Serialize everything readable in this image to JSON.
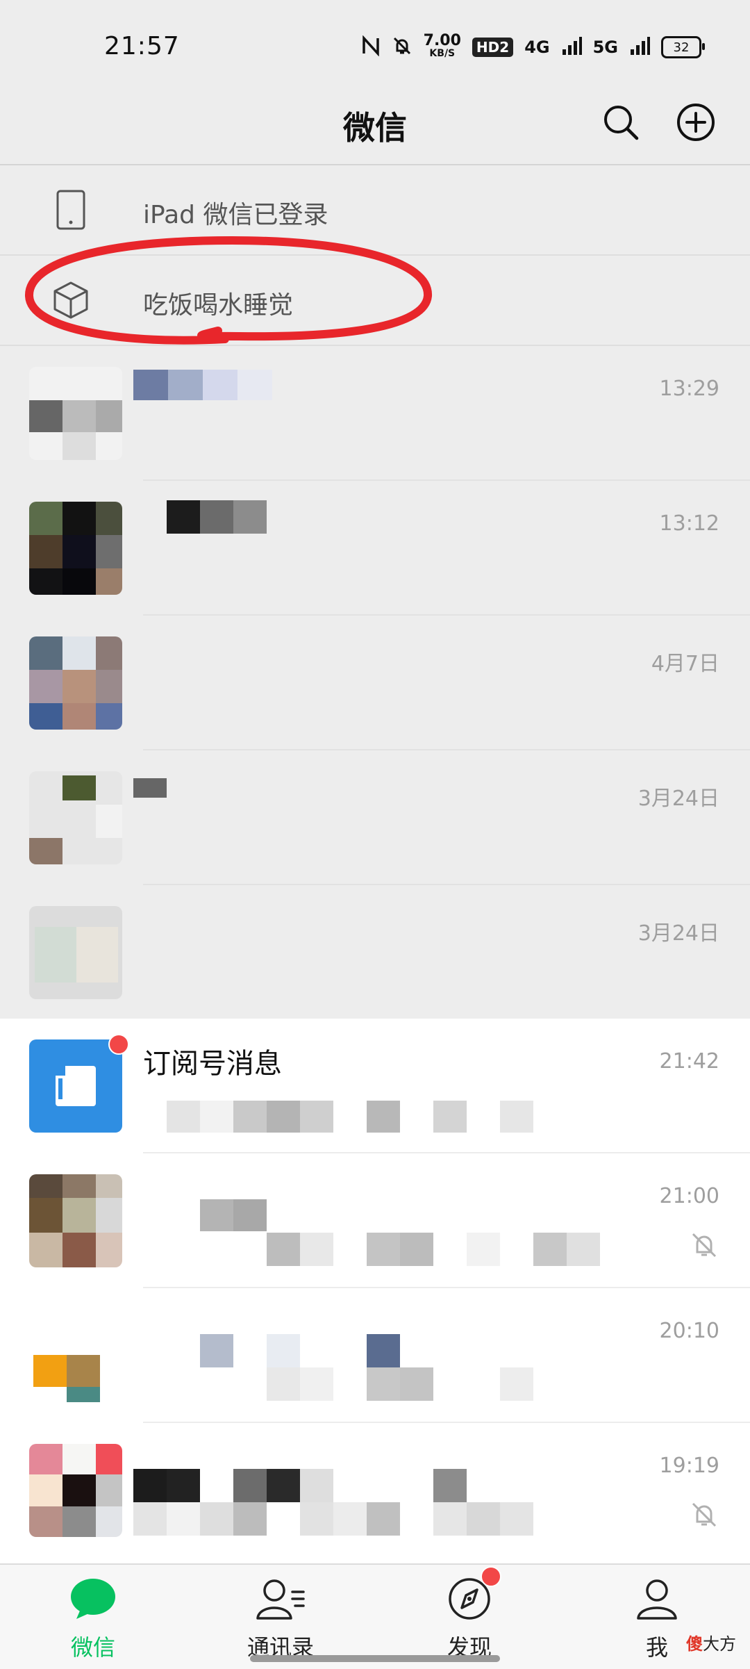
{
  "status_bar": {
    "time": "21:57",
    "speed_value": "7.00",
    "speed_unit": "KB/S",
    "hd_label": "HD2",
    "net_4g": "4G",
    "net_5g": "5G",
    "battery": "32"
  },
  "header": {
    "title": "微信"
  },
  "device_row": {
    "text": "iPad 微信已登录"
  },
  "fold_row": {
    "text": "吃饭喝水睡觉"
  },
  "chats": [
    {
      "time": "13:29",
      "muted": false
    },
    {
      "time": "13:12",
      "muted": false
    },
    {
      "time": "4月7日",
      "muted": false
    },
    {
      "time": "3月24日",
      "muted": false
    },
    {
      "time": "3月24日",
      "muted": false
    },
    {
      "name": "订阅号消息",
      "time": "21:42",
      "muted": false,
      "badge": true
    },
    {
      "time": "21:00",
      "muted": true
    },
    {
      "time": "20:10",
      "muted": false
    },
    {
      "time": "19:19",
      "muted": true
    }
  ],
  "tabs": [
    {
      "label": "微信",
      "active": true
    },
    {
      "label": "通讯录",
      "active": false
    },
    {
      "label": "发现",
      "active": false,
      "badge": true
    },
    {
      "label": "我",
      "active": false
    }
  ],
  "watermark": {
    "red": "傻",
    "rest": "大方"
  },
  "colors": {
    "accent": "#07c160",
    "badge": "#f24747",
    "subscription": "#2f8ee2"
  }
}
